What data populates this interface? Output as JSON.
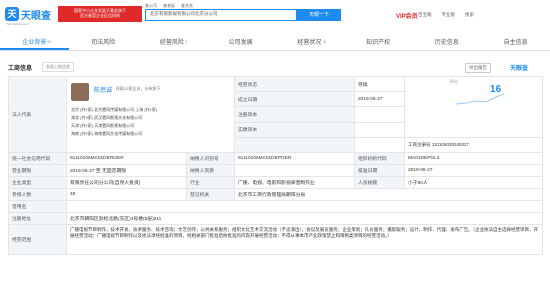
{
  "header": {
    "logo_text": "天眼查",
    "logo_sub": "TianYanCha.com",
    "promo_line1": "国家中小企业发展子基金旗下",
    "promo_line2": "官方备案企业征信机构",
    "search_tabs": [
      "查公司",
      "查老板",
      "查关系"
    ],
    "search_value": "北京有限影视有限公司北京分公司",
    "search_button": "天眼一下",
    "vip": "VIP会员",
    "nav": [
      "百宝箱",
      "专业版",
      "搜索"
    ]
  },
  "tabs": [
    {
      "label": "企业背景",
      "count": "53"
    },
    {
      "label": "司法风险",
      "count": ""
    },
    {
      "label": "经营风险",
      "count": "3"
    },
    {
      "label": "公司发展",
      "count": ""
    },
    {
      "label": "经营状况",
      "count": "15"
    },
    {
      "label": "知识产权",
      "count": ""
    },
    {
      "label": "历史信息",
      "count": ""
    },
    {
      "label": "自主信息",
      "count": ""
    }
  ],
  "section": {
    "title": "工商信息",
    "sub": "发起上报信息",
    "export": "导出报告",
    "brand": "天眼查"
  },
  "legal": {
    "label": "法人代表",
    "name": "陈思诚",
    "sub": "任职12家企业，分布如下",
    "lines": [
      "北京  (共1家)   北京壹同传媒有限公司   上海  (共1家)",
      "湖北  (共3家)   武汉壹同影视文化有限公司",
      "天津  (共1家)   天津壹同影视有限公司",
      "海南  (共2家)   海南壹同文化传媒有限公司"
    ]
  },
  "right": {
    "status_label": "经营状态",
    "status": "存续",
    "date_label": "成立日期",
    "date": "2018-05-27",
    "capital_label": "注册资本",
    "capital": "",
    "capital_note_label": "实缴资本",
    "score_label": "评分",
    "score": "16",
    "reg_no_label": "工商注册号",
    "reg_no": "110105025345327"
  },
  "rows": [
    [
      "统一社会信用代码",
      "91110105MA01DERGER",
      "纳税人识别号",
      "91110105MA01DEPGER",
      "组织机构代码",
      "MA01DEPGL3"
    ],
    [
      "营业期限",
      "2018-05-27 至 无固定期限",
      "纳税人资质",
      "",
      "核准日期",
      "2018-05-27"
    ],
    [
      "企业类型",
      "有限责任公司分公司(自然人投资)",
      "行业",
      "广播、电视、电影和影视录音制作业",
      "人员规模",
      "小于50人"
    ],
    [
      "参保人数",
      "49",
      "登记机关",
      "北京市工商行政管理局朝阳分局",
      "",
      ""
    ],
    [
      "曾用名",
      "",
      "",
      "",
      "",
      ""
    ],
    [
      "注册地址",
      "北京市朝阳区劲松北路(东区)3号楼(5层)211",
      "",
      "",
      "",
      ""
    ]
  ],
  "scope_label": "经营范围",
  "scope": "广播电视节目制作；技术开发、技术服务、技术咨询；文艺创作；公共关系服务；组织文化艺术交流活动（不含演出）；会议及展览服务；企业策划；礼仪服务；摄影服务；设计、制作、代理、发布广告。（企业依法自主选择经营项目，开展经营活动；广播电视节目制作以及依法须经批准的项目，经相关部门批准后依批准的内容开展经营活动；不得从事本市产业政策禁止和限制类项目的经营活动。）"
}
